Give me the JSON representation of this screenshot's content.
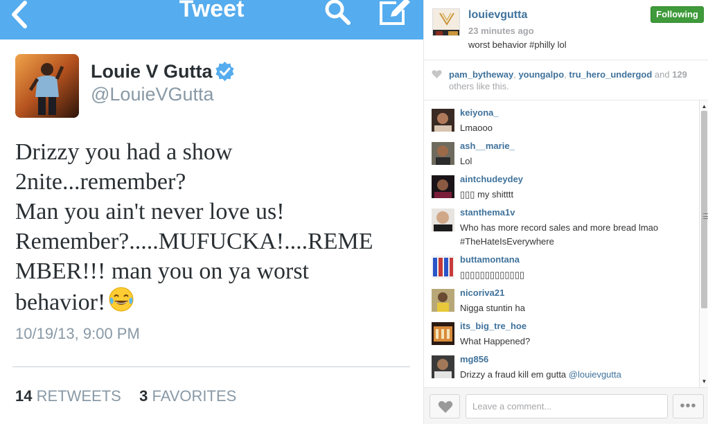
{
  "twitter": {
    "header_title": "Tweet",
    "author_name": "Louie V Gutta",
    "author_handle": "@LouieVGutta",
    "tweet_text": "Drizzy you had a show\n2nite...remember?\nMan you ain't never love us!\nRemember?.....MUFUCKA!....REME\nMBER!!! man you on ya worst\nbehavior!",
    "emoji": "face-with-tears-of-joy",
    "timestamp": "10/19/13, 9:00 PM",
    "retweets_count": "14",
    "retweets_label": "RETWEETS",
    "favorites_count": "3",
    "favorites_label": "FAVORITES",
    "colors": {
      "bar": "#55acee",
      "verified": "#55acee"
    }
  },
  "instagram": {
    "username": "louievgutta",
    "time_ago": "23 minutes ago",
    "caption": "worst behavior #philly lol",
    "follow_label": "Following",
    "likes": {
      "users": [
        "pam_bytheway",
        "youngalpo",
        "tru_hero_undergod"
      ],
      "sep1": ", ",
      "sep2": ", ",
      "and_text": " and ",
      "count": "129",
      "suffix": " others like this."
    },
    "comments": [
      {
        "user": "keiyona_",
        "text": "Lmaooo"
      },
      {
        "user": "ash__marie_",
        "text": "Lol"
      },
      {
        "user": "aintchudeydey",
        "text": "▯▯▯ my shitttt"
      },
      {
        "user": "stanthema1v",
        "text": "Who has more record sales and more bread lmao #TheHateIsEverywhere"
      },
      {
        "user": "buttamontana",
        "text": "▯▯▯▯▯▯▯▯▯▯▯▯▯"
      },
      {
        "user": "nicoriva21",
        "text": "Nigga stuntin ha"
      },
      {
        "user": "its_big_tre_hoe",
        "text": "What Happened?"
      },
      {
        "user": "mg856",
        "text": "Drizzy a fraud kill em gutta ",
        "mention": "@louievgutta"
      }
    ],
    "comment_placeholder": "Leave a comment...",
    "more_label": "•••",
    "colors": {
      "link": "#3f729b",
      "following": "#3e9a3a"
    }
  }
}
